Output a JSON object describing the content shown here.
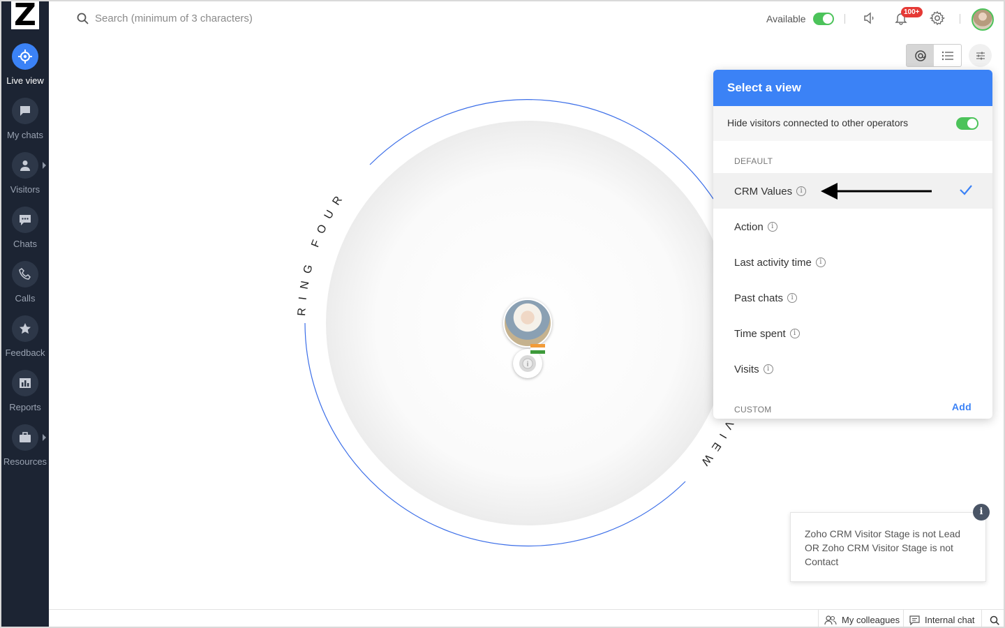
{
  "app": {
    "logo": "Z"
  },
  "sidebar": {
    "items": [
      {
        "label": "Live view",
        "icon": "live-view-icon",
        "active": true
      },
      {
        "label": "My chats",
        "icon": "chat-bubble-icon"
      },
      {
        "label": "Visitors",
        "icon": "person-icon"
      },
      {
        "label": "Chats",
        "icon": "chats-icon"
      },
      {
        "label": "Calls",
        "icon": "phone-icon"
      },
      {
        "label": "Feedback",
        "icon": "star-icon"
      },
      {
        "label": "Reports",
        "icon": "bar-chart-icon"
      },
      {
        "label": "Resources",
        "icon": "briefcase-icon"
      }
    ]
  },
  "topbar": {
    "search_placeholder": "Search (minimum of 3 characters)",
    "availability_label": "Available",
    "notification_badge": "100+"
  },
  "ring": {
    "left_text": "RING FOUR",
    "right_text": "VIEW"
  },
  "view_menu": {
    "title": "Select a view",
    "hide_visitors_label": "Hide visitors connected to other operators",
    "hide_visitors_on": true,
    "default_section": "DEFAULT",
    "items": [
      {
        "label": "CRM Values",
        "selected": true
      },
      {
        "label": "Action"
      },
      {
        "label": "Last activity time"
      },
      {
        "label": "Past chats"
      },
      {
        "label": "Time spent"
      },
      {
        "label": "Visits"
      }
    ],
    "custom_section": "CUSTOM",
    "add_label": "Add"
  },
  "info_card": {
    "text": "Zoho CRM Visitor Stage is not Lead OR Zoho CRM Visitor Stage is not Contact",
    "icon_glyph": "i"
  },
  "bottom_bar": {
    "colleagues": "My colleagues",
    "internal_chat": "Internal chat"
  },
  "colors": {
    "accent": "#3b82f6",
    "sidebar": "#1c2433",
    "toggle_on": "#4cc35a",
    "badge": "#e53935"
  }
}
